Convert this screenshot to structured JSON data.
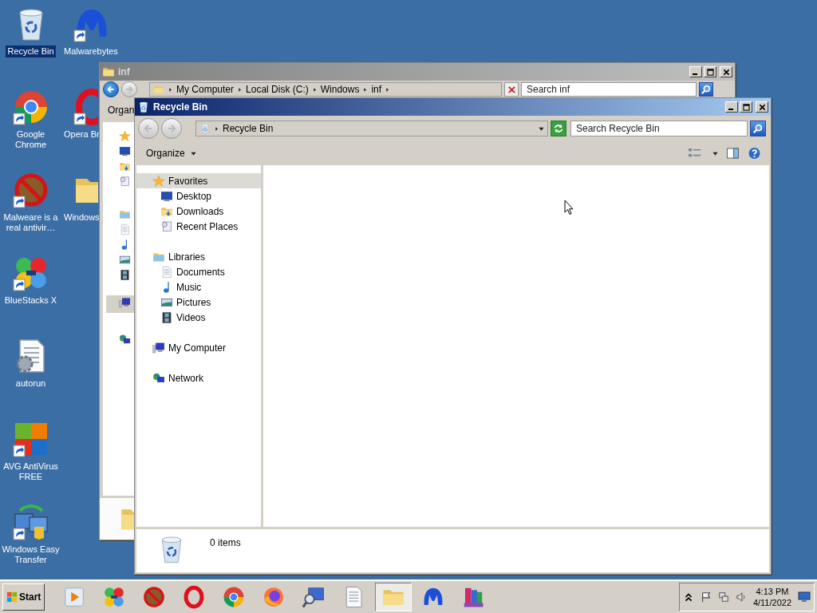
{
  "desktop": {
    "columns": [
      {
        "icons": [
          {
            "kind": "recycle",
            "label": "Recycle Bin",
            "shortcut": false,
            "selected": true
          },
          {
            "kind": "chrome",
            "label": "Google Chrome",
            "shortcut": true,
            "selected": false
          },
          {
            "kind": "noentry",
            "label": "Malweare is a real antivir…",
            "shortcut": true,
            "selected": false
          },
          {
            "kind": "bluestacks",
            "label": "BlueStacks X",
            "shortcut": true,
            "selected": false
          },
          {
            "kind": "autorun",
            "label": "autorun",
            "shortcut": false,
            "selected": false
          },
          {
            "kind": "avg",
            "label": "AVG AntiVirus FREE",
            "shortcut": true,
            "selected": false
          },
          {
            "kind": "easytransfer",
            "label": "Windows Easy Transfer",
            "shortcut": true,
            "selected": false
          }
        ]
      },
      {
        "icons": [
          {
            "kind": "malwarebytes",
            "label": "Malwarebytes",
            "shortcut": true,
            "selected": false
          },
          {
            "kind": "opera",
            "label": "Opera Br",
            "shortcut": true,
            "selected": false
          },
          {
            "kind": "folder",
            "label": "Windows",
            "shortcut": false,
            "selected": false
          }
        ]
      }
    ]
  },
  "back_window": {
    "title": "inf",
    "active": false,
    "breadcrumbs": [
      "My Computer",
      "Local Disk (C:)",
      "Windows",
      "inf"
    ],
    "search": {
      "placeholder": "Search inf"
    },
    "toolbar": {
      "organize": "Organ"
    }
  },
  "window": {
    "title": "Recycle Bin",
    "active": true,
    "address": "Recycle Bin",
    "search": {
      "placeholder": "Search Recycle Bin"
    },
    "toolbar": {
      "organize": "Organize"
    },
    "nav": [
      {
        "kind": "star",
        "label": "Favorites",
        "selected": true,
        "children": [
          {
            "kind": "desktop",
            "label": "Desktop",
            "selected": false
          },
          {
            "kind": "downloads",
            "label": "Downloads",
            "selected": false
          },
          {
            "kind": "recent",
            "label": "Recent Places",
            "selected": false
          }
        ]
      },
      {
        "kind": "libraries",
        "label": "Libraries",
        "selected": false,
        "children": [
          {
            "kind": "documents",
            "label": "Documents",
            "selected": false
          },
          {
            "kind": "music",
            "label": "Music",
            "selected": false
          },
          {
            "kind": "pictures",
            "label": "Pictures",
            "selected": false
          },
          {
            "kind": "videos",
            "label": "Videos",
            "selected": false
          }
        ]
      },
      {
        "kind": "computer",
        "label": "My Computer",
        "selected": false
      },
      {
        "kind": "network",
        "label": "Network",
        "selected": false
      }
    ],
    "status": {
      "count": "0 items"
    }
  },
  "taskbar": {
    "start": "Start",
    "apps": [
      {
        "kind": "media",
        "selected": false
      },
      {
        "kind": "bluestacks",
        "selected": false
      },
      {
        "kind": "noentry",
        "selected": false
      },
      {
        "kind": "opera",
        "selected": false
      },
      {
        "kind": "chrome",
        "selected": false
      },
      {
        "kind": "firefox",
        "selected": false
      },
      {
        "kind": "magnifier",
        "selected": false
      },
      {
        "kind": "document",
        "selected": false
      },
      {
        "kind": "explorer",
        "selected": true
      },
      {
        "kind": "malwarebytes",
        "selected": false
      },
      {
        "kind": "winrar",
        "selected": false
      }
    ],
    "time": "4:13 PM",
    "date": "4/11/2022"
  }
}
